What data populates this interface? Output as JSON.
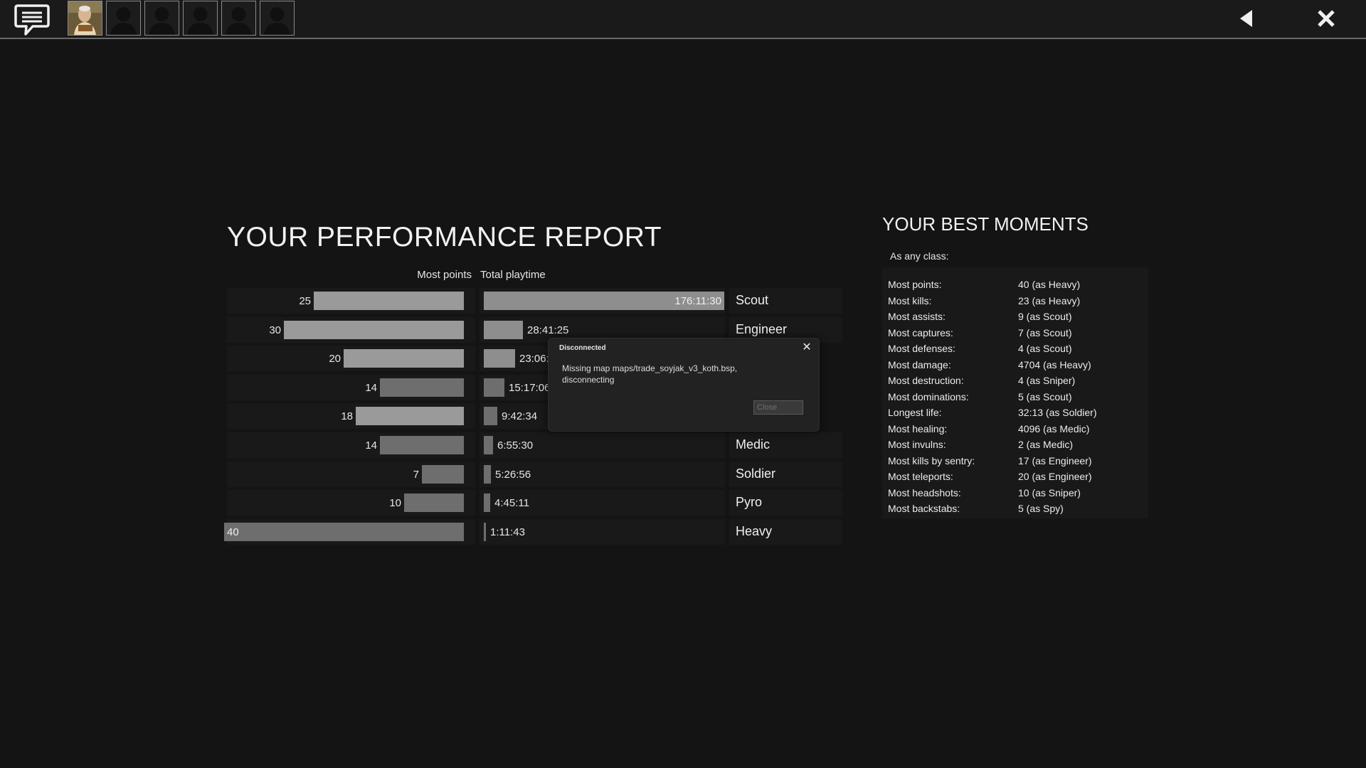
{
  "topbar": {
    "icons": {
      "chat": "chat-bubble-icon",
      "back": "back-arrow-icon",
      "close": "close-x-icon"
    },
    "avatars": [
      {
        "type": "photo"
      },
      {
        "type": "silhouette"
      },
      {
        "type": "silhouette"
      },
      {
        "type": "silhouette"
      },
      {
        "type": "silhouette"
      },
      {
        "type": "silhouette"
      }
    ]
  },
  "report": {
    "title": "YOUR PERFORMANCE REPORT",
    "col_points": "Most points",
    "col_playtime": "Total playtime",
    "max_points": 40,
    "playtime_max_hours": 176.19,
    "rows": [
      {
        "points": "25",
        "points_num": 25,
        "playtime": "176:11:30",
        "playtime_hours": 176.19,
        "cls": "Scout"
      },
      {
        "points": "30",
        "points_num": 30,
        "playtime": "28:41:25",
        "playtime_hours": 28.69,
        "cls": "Engineer"
      },
      {
        "points": "20",
        "points_num": 20,
        "playtime": "23:06:4",
        "playtime_hours": 23.1,
        "cls": ""
      },
      {
        "points": "14",
        "points_num": 14,
        "playtime": "15:17:06",
        "playtime_hours": 15.29,
        "cls": ""
      },
      {
        "points": "18",
        "points_num": 18,
        "playtime": "9:42:34",
        "playtime_hours": 9.71,
        "cls": ""
      },
      {
        "points": "14",
        "points_num": 14,
        "playtime": "6:55:30",
        "playtime_hours": 6.93,
        "cls": "Medic"
      },
      {
        "points": "7",
        "points_num": 7,
        "playtime": "5:26:56",
        "playtime_hours": 5.45,
        "cls": "Soldier"
      },
      {
        "points": "10",
        "points_num": 10,
        "playtime": "4:45:11",
        "playtime_hours": 4.75,
        "cls": "Pyro"
      },
      {
        "points": "40",
        "points_num": 40,
        "playtime": "1:11:43",
        "playtime_hours": 1.2,
        "cls": "Heavy"
      }
    ]
  },
  "moments": {
    "title": "YOUR BEST MOMENTS",
    "subtitle": "As any class:",
    "items": [
      {
        "label": "Most points:",
        "value": "40 (as Heavy)"
      },
      {
        "label": "Most kills:",
        "value": "23 (as Heavy)"
      },
      {
        "label": "Most assists:",
        "value": "9 (as Scout)"
      },
      {
        "label": "Most captures:",
        "value": "7 (as Scout)"
      },
      {
        "label": "Most defenses:",
        "value": "4 (as Scout)"
      },
      {
        "label": "Most damage:",
        "value": "4704 (as Heavy)"
      },
      {
        "label": "Most destruction:",
        "value": "4 (as Sniper)"
      },
      {
        "label": "Most dominations:",
        "value": "5 (as Scout)"
      },
      {
        "label": "Longest life:",
        "value": "32:13 (as Soldier)"
      },
      {
        "label": "Most healing:",
        "value": "4096 (as Medic)"
      },
      {
        "label": "Most invulns:",
        "value": "2 (as Medic)"
      },
      {
        "label": "Most kills by sentry:",
        "value": "17 (as Engineer)"
      },
      {
        "label": "Most teleports:",
        "value": "20 (as Engineer)"
      },
      {
        "label": "Most headshots:",
        "value": "10 (as Sniper)"
      },
      {
        "label": "Most backstabs:",
        "value": "5 (as Spy)"
      }
    ]
  },
  "dialog": {
    "title": "Disconnected",
    "message": "Missing map maps/trade_soyjak_v3_koth.bsp, disconnecting",
    "close_label": "Close",
    "close_icon": "close-x-icon"
  },
  "colors": {
    "background": "#141414",
    "bar_light": "#9a9a9a",
    "bar_dark": "#6e6e6e",
    "cell": "#191919"
  }
}
